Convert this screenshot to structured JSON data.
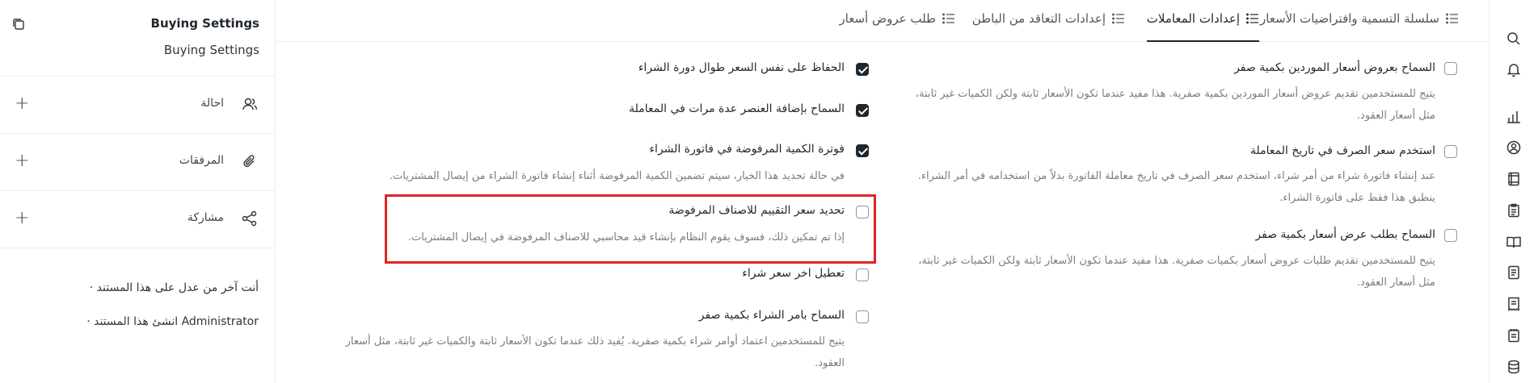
{
  "sidebar": {
    "title": "Buying Settings",
    "subtitle": "Buying Settings",
    "rows": [
      {
        "label": "احالة"
      },
      {
        "label": "المرفقات"
      },
      {
        "label": "مشاركة"
      }
    ],
    "activity": [
      "أنت آخر من عدل على هذا المستند ·",
      "Administrator انشئ هذا المستند ·"
    ]
  },
  "tabs": [
    {
      "label": "سلسلة التسمية وافتراضيات الأسعار",
      "active": false
    },
    {
      "label": "إعدادات المعاملات",
      "active": true
    },
    {
      "label": "إعدادات التعاقد من الباطن",
      "active": false
    },
    {
      "label": "طلب عروض أسعار",
      "active": false
    }
  ],
  "fields_right": [
    {
      "label": "السماح بعروض أسعار الموردين بكمية صفر",
      "checked": false,
      "desc": "يتيح للمستخدمين تقديم عروض أسعار الموردين بكمية صفرية. هذا مفيد عندما تكون الأسعار ثابتة ولكن الكميات غير ثابتة، مثل أسعار العقود."
    },
    {
      "label": "استخدم سعر الصرف في تاريخ المعاملة",
      "checked": false,
      "desc": "عند إنشاء فاتورة شراء من أمر شراء، استخدم سعر الصرف في تاريخ معاملة الفاتورة بدلاً من استخدامه في أمر الشراء. ينطبق هذا فقط على فاتورة الشراء."
    },
    {
      "label": "السماح بطلب عرض أسعار بكمية صفر",
      "checked": false,
      "desc": "يتيح للمستخدمين تقديم طلبات عروض أسعار بكميات صفرية. هذا مفيد عندما تكون الأسعار ثابتة ولكن الكميات غير ثابتة، مثل أسعار العقود."
    }
  ],
  "fields_left": [
    {
      "label": "الحفاظ على نفس السعر طوال دورة الشراء",
      "checked": true,
      "desc": ""
    },
    {
      "label": "السماح بإضافة العنصر عدة مرات في المعاملة",
      "checked": true,
      "desc": ""
    },
    {
      "label": "فوترة الكمية المرفوضة في فاتورة الشراء",
      "checked": true,
      "desc": "في حالة تحديد هذا الخيار، سيتم تضمين الكمية المرفوضة أثناء إنشاء فاتورة الشراء من إيصال المشتريات."
    },
    {
      "label": "تحديد سعر التقييم للاصناف المرفوضة",
      "checked": false,
      "desc": "إذا تم تمكين ذلك، فسوف يقوم النظام بإنشاء قيد محاسبي للاصناف المرفوضة في إيصال المشتريات."
    },
    {
      "label": "تعطيل اخر سعر شراء",
      "checked": false,
      "desc": ""
    },
    {
      "label": "السماح بامر الشراء بكمية صفر",
      "checked": false,
      "desc": "يتيح للمستخدمين اعتماد أوامر شراء بكمية صفرية. يُفيد ذلك عندما تكون الأسعار ثابتة والكميات غير ثابتة، مثل أسعار العقود."
    }
  ],
  "colors": {
    "highlight": "#e02424",
    "checkbox_checked": "#1f272e"
  }
}
